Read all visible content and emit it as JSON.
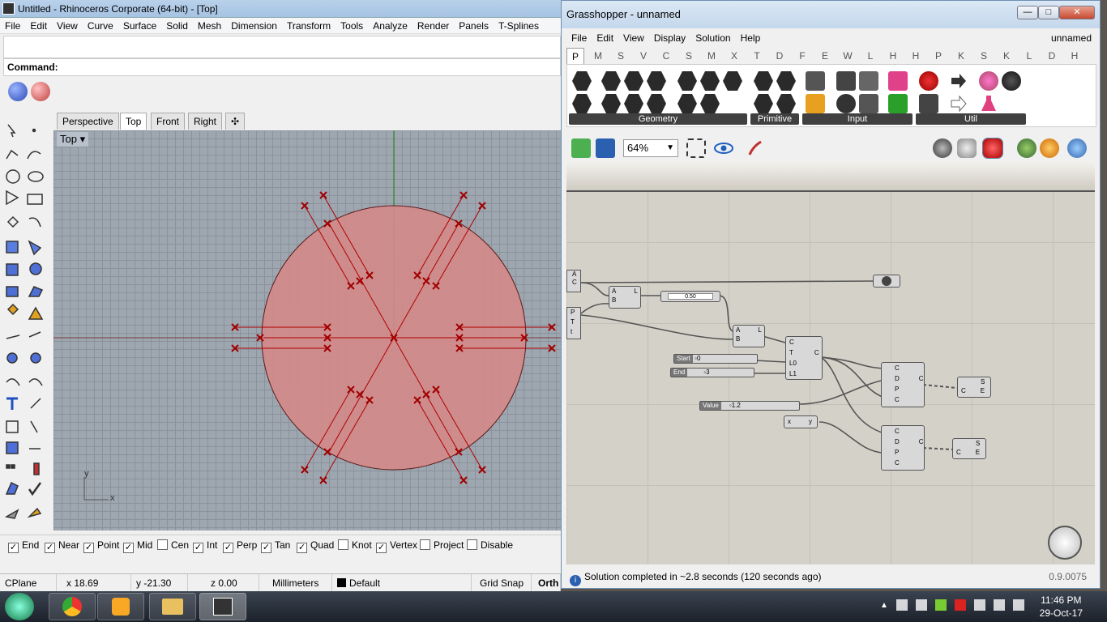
{
  "rhino": {
    "title": "Untitled - Rhinoceros Corporate (64-bit) - [Top]",
    "menu": [
      "File",
      "Edit",
      "View",
      "Curve",
      "Surface",
      "Solid",
      "Mesh",
      "Dimension",
      "Transform",
      "Tools",
      "Analyze",
      "Render",
      "Panels",
      "T-Splines"
    ],
    "command_label": "Command:",
    "viewport_tabs": [
      "Perspective",
      "Top",
      "Front",
      "Right"
    ],
    "active_tab": "Top",
    "viewport_label": "Top",
    "axis_y": "y",
    "axis_x": "x",
    "osnaps": [
      {
        "label": "End",
        "checked": true
      },
      {
        "label": "Near",
        "checked": true
      },
      {
        "label": "Point",
        "checked": true
      },
      {
        "label": "Mid",
        "checked": true
      },
      {
        "label": "Cen",
        "checked": false
      },
      {
        "label": "Int",
        "checked": true
      },
      {
        "label": "Perp",
        "checked": true
      },
      {
        "label": "Tan",
        "checked": true
      },
      {
        "label": "Quad",
        "checked": true
      },
      {
        "label": "Knot",
        "checked": false
      },
      {
        "label": "Vertex",
        "checked": true
      },
      {
        "label": "Project",
        "checked": false
      },
      {
        "label": "Disable",
        "checked": false
      }
    ],
    "status": {
      "cplane": "CPlane",
      "x": "x 18.69",
      "y": "y -21.30",
      "z": "z 0.00",
      "units": "Millimeters",
      "layer": "Default",
      "gridsnap": "Grid Snap",
      "ortho": "Orth"
    },
    "colors": {
      "disk": "#d98f8f",
      "curve": "#b00000",
      "green_axis": "#2e8b2e"
    }
  },
  "gh": {
    "title": "Grasshopper - unnamed",
    "window_buttons": [
      "—",
      "□",
      "✕"
    ],
    "menu": [
      "File",
      "Edit",
      "View",
      "Display",
      "Solution",
      "Help"
    ],
    "doc_name": "unnamed",
    "tabs": [
      "P",
      "M",
      "S",
      "V",
      "C",
      "S",
      "M",
      "X",
      "T",
      "D",
      "F",
      "E",
      "W",
      "L",
      "H",
      "H",
      "P",
      "K",
      "S",
      "K",
      "L",
      "D",
      "H"
    ],
    "ribbon_groups": [
      "Geometry",
      "Primitive",
      "Input",
      "Util"
    ],
    "zoom": "64%",
    "nodes": {
      "pt_a": "A",
      "pt_c": "C",
      "line_a": "A",
      "line_b": "B",
      "line_l": "L",
      "slider_half": "0.50",
      "ptl_p": "P",
      "ptl_t": "T",
      "ptl_t2": "t",
      "line2_a": "A",
      "line2_b": "B",
      "line2_l": "L",
      "arc_c": "C",
      "arc_t": "T",
      "arc_l0": "L0",
      "arc_l1": "L1",
      "arc_out": "C",
      "start_label": "Start",
      "start_val": "0",
      "end_label": "End",
      "end_val": "3",
      "value_label": "Value",
      "value_val": "1.2",
      "expr_x": "x",
      "expr_y": "y",
      "off1_c": "C",
      "off1_d": "D",
      "off1_p": "P",
      "off1_c2": "C",
      "off1_out": "C",
      "off2_c": "C",
      "off2_d": "D",
      "off2_p": "P",
      "off2_c2": "C",
      "off2_out": "C",
      "srf1_c": "C",
      "srf1_s": "S",
      "srf1_e": "E",
      "srf2_c": "C",
      "srf2_s": "S",
      "srf2_e": "E"
    },
    "status": "Solution completed in ~2.8 seconds (120 seconds ago)",
    "version": "0.9.0075"
  },
  "taskbar": {
    "time": "11:46 PM",
    "date": "29-Oct-17"
  }
}
